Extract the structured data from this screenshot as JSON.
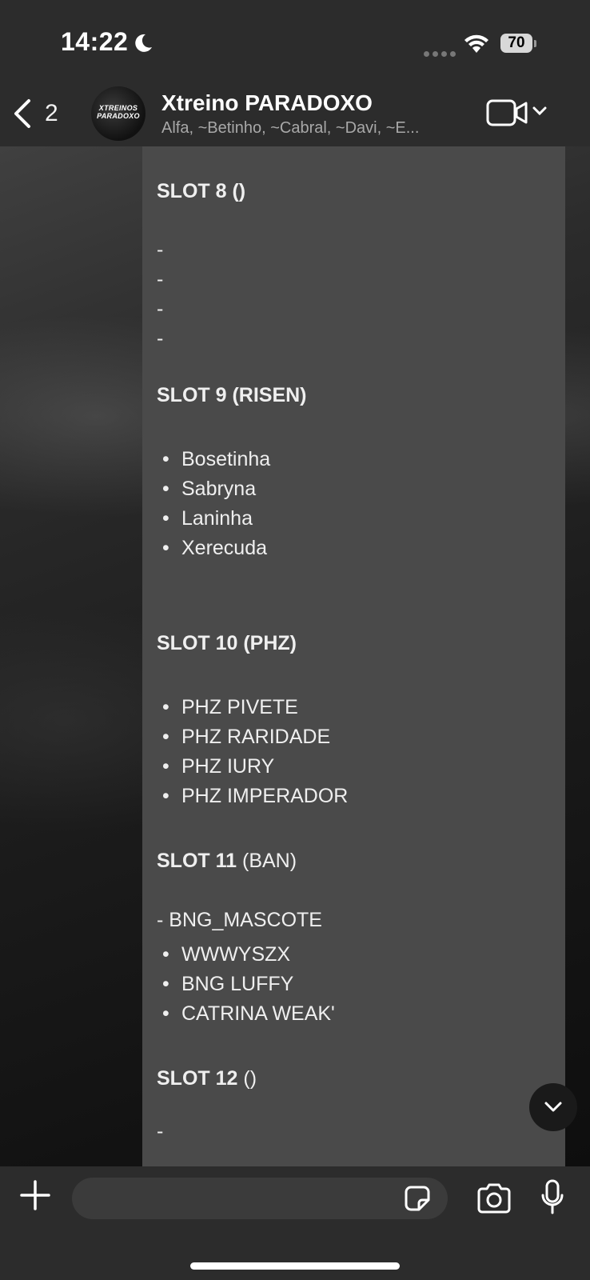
{
  "status_bar": {
    "time": "14:22",
    "battery": "70"
  },
  "header": {
    "back_count": "2",
    "avatar_logo_text": "XTREINOS PARADOXO",
    "title": "Xtreino PARADOXO",
    "subtitle": "Alfa, ~Betinho, ~Cabral, ~Davi, ~E..."
  },
  "message": {
    "lines": [
      {
        "kind": "heading",
        "bold": "SLOT 8 ()",
        "rest": ""
      },
      {
        "kind": "dash",
        "text": "-"
      },
      {
        "kind": "dash",
        "text": "-"
      },
      {
        "kind": "dash",
        "text": "-"
      },
      {
        "kind": "dash",
        "text": "-"
      },
      {
        "kind": "heading",
        "bold": "SLOT 9 (RISEN)",
        "rest": ""
      },
      {
        "kind": "bullet",
        "text": "Bosetinha"
      },
      {
        "kind": "bullet",
        "text": "Sabryna"
      },
      {
        "kind": "bullet",
        "text": "Laninha"
      },
      {
        "kind": "bullet",
        "text": "Xerecuda"
      },
      {
        "kind": "heading",
        "bold": "SLOT 10 (PHZ)",
        "rest": ""
      },
      {
        "kind": "bullet",
        "text": "PHZ PIVETE"
      },
      {
        "kind": "bullet",
        "text": "PHZ RARIDADE"
      },
      {
        "kind": "bullet",
        "text": "PHZ IURY"
      },
      {
        "kind": "bullet",
        "text": "PHZ IMPERADOR"
      },
      {
        "kind": "heading",
        "bold": "SLOT 11",
        "rest": " (BAN)"
      },
      {
        "kind": "dash",
        "text": "-  BNG_MASCOTE"
      },
      {
        "kind": "bullet",
        "text": "WWWYSZX"
      },
      {
        "kind": "bullet",
        "text": "BNG LUFFY"
      },
      {
        "kind": "bullet",
        "text": "CATRINA WEAK'"
      },
      {
        "kind": "heading",
        "bold": "SLOT 12",
        "rest": " ()"
      },
      {
        "kind": "dash",
        "text": "-"
      }
    ]
  },
  "composer": {
    "placeholder": ""
  }
}
